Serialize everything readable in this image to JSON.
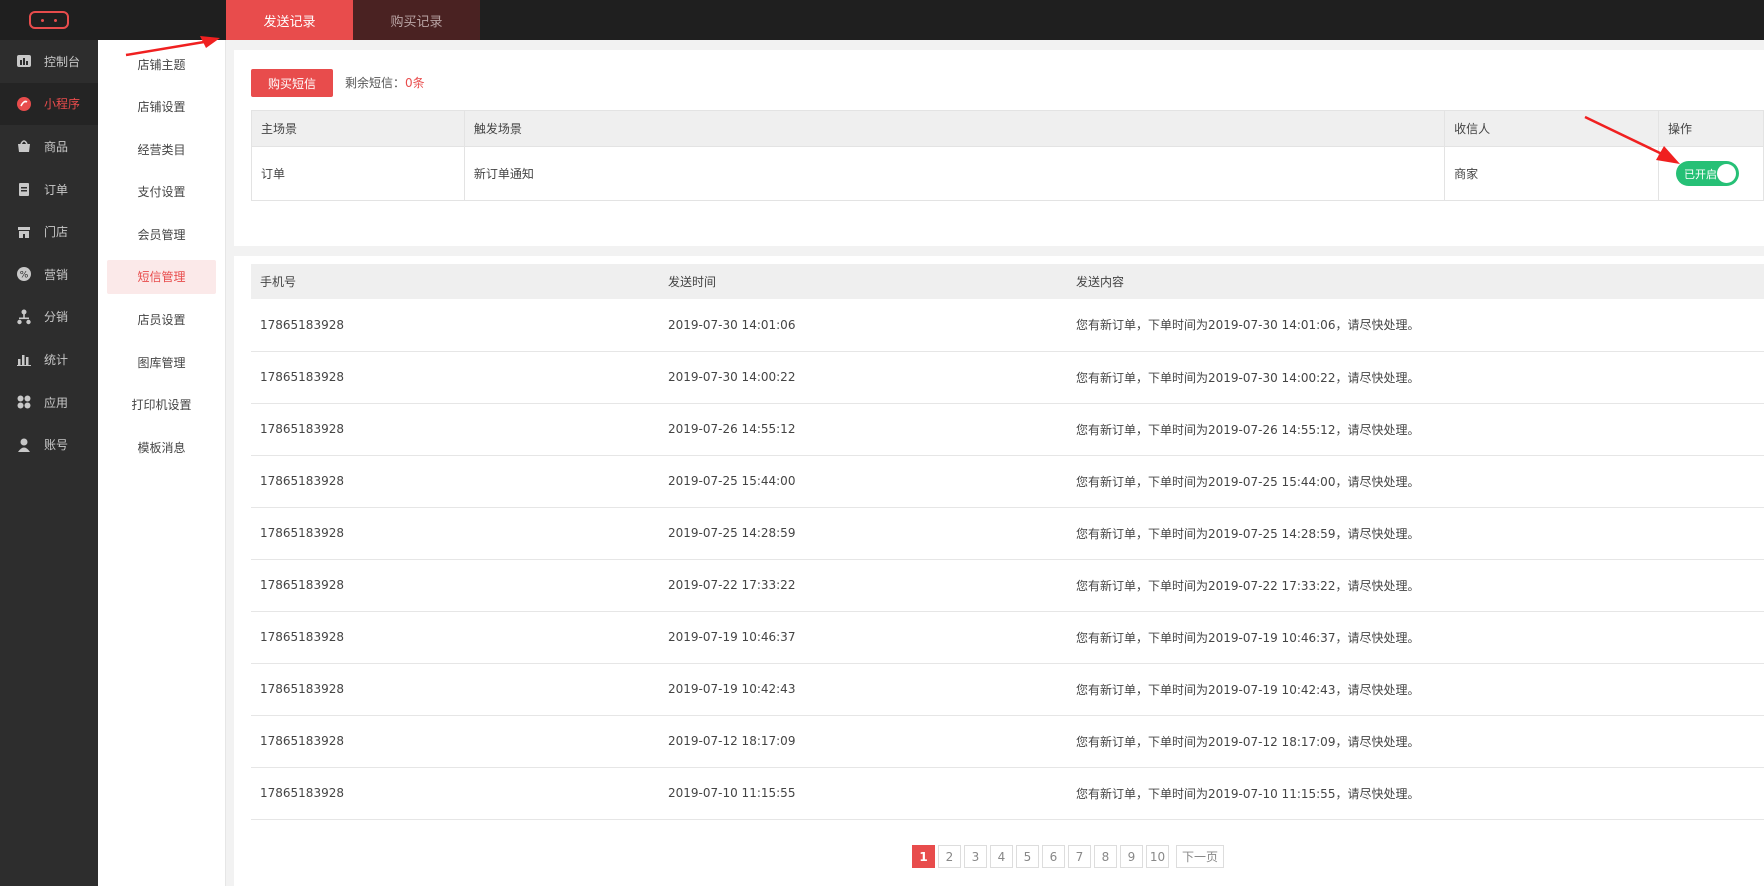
{
  "header": {
    "tabs": [
      {
        "label": "发送记录",
        "active": true
      },
      {
        "label": "购买记录",
        "active": false
      }
    ]
  },
  "sidebar": {
    "items": [
      {
        "label": "控制台",
        "icon": "dashboard-icon"
      },
      {
        "label": "小程序",
        "icon": "mini-program-icon",
        "active": true
      },
      {
        "label": "商品",
        "icon": "goods-icon"
      },
      {
        "label": "订单",
        "icon": "order-icon"
      },
      {
        "label": "门店",
        "icon": "store-icon"
      },
      {
        "label": "营销",
        "icon": "marketing-icon"
      },
      {
        "label": "分销",
        "icon": "distribution-icon"
      },
      {
        "label": "统计",
        "icon": "statistics-icon"
      },
      {
        "label": "应用",
        "icon": "apps-icon"
      },
      {
        "label": "账号",
        "icon": "account-icon"
      }
    ]
  },
  "subnav": {
    "items": [
      "店铺主题",
      "店铺设置",
      "经营类目",
      "支付设置",
      "会员管理",
      "短信管理",
      "店员设置",
      "图库管理",
      "打印机设置",
      "模板消息"
    ],
    "active_index": 5
  },
  "sms": {
    "buy_label": "购买短信",
    "remain_label": "剩余短信：",
    "remain_count": "0条"
  },
  "scene_table": {
    "headers": [
      "主场景",
      "触发场景",
      "收信人",
      "操作"
    ],
    "row": {
      "main": "订单",
      "trigger": "新订单通知",
      "receiver": "商家",
      "toggle_label": "已开启"
    }
  },
  "records": {
    "headers": [
      "手机号",
      "发送时间",
      "发送内容"
    ],
    "rows": [
      {
        "phone": "17865183928",
        "time": "2019-07-30 14:01:06",
        "content": "您有新订单，下单时间为2019-07-30 14:01:06，请尽快处理。"
      },
      {
        "phone": "17865183928",
        "time": "2019-07-30 14:00:22",
        "content": "您有新订单，下单时间为2019-07-30 14:00:22，请尽快处理。"
      },
      {
        "phone": "17865183928",
        "time": "2019-07-26 14:55:12",
        "content": "您有新订单，下单时间为2019-07-26 14:55:12，请尽快处理。"
      },
      {
        "phone": "17865183928",
        "time": "2019-07-25 15:44:00",
        "content": "您有新订单，下单时间为2019-07-25 15:44:00，请尽快处理。"
      },
      {
        "phone": "17865183928",
        "time": "2019-07-25 14:28:59",
        "content": "您有新订单，下单时间为2019-07-25 14:28:59，请尽快处理。"
      },
      {
        "phone": "17865183928",
        "time": "2019-07-22 17:33:22",
        "content": "您有新订单，下单时间为2019-07-22 17:33:22，请尽快处理。"
      },
      {
        "phone": "17865183928",
        "time": "2019-07-19 10:46:37",
        "content": "您有新订单，下单时间为2019-07-19 10:46:37，请尽快处理。"
      },
      {
        "phone": "17865183928",
        "time": "2019-07-19 10:42:43",
        "content": "您有新订单，下单时间为2019-07-19 10:42:43，请尽快处理。"
      },
      {
        "phone": "17865183928",
        "time": "2019-07-12 18:17:09",
        "content": "您有新订单，下单时间为2019-07-12 18:17:09，请尽快处理。"
      },
      {
        "phone": "17865183928",
        "time": "2019-07-10 11:15:55",
        "content": "您有新订单，下单时间为2019-07-10 11:15:55，请尽快处理。"
      }
    ]
  },
  "pagination": {
    "pages": [
      "1",
      "2",
      "3",
      "4",
      "5",
      "6",
      "7",
      "8",
      "9",
      "10"
    ],
    "current": "1",
    "next_label": "下一页"
  },
  "colors": {
    "accent": "#e84c4c",
    "toggle_on": "#26c076",
    "sidebar_bg": "#2d2d2d",
    "topbar_bg": "#1f1f1f"
  }
}
